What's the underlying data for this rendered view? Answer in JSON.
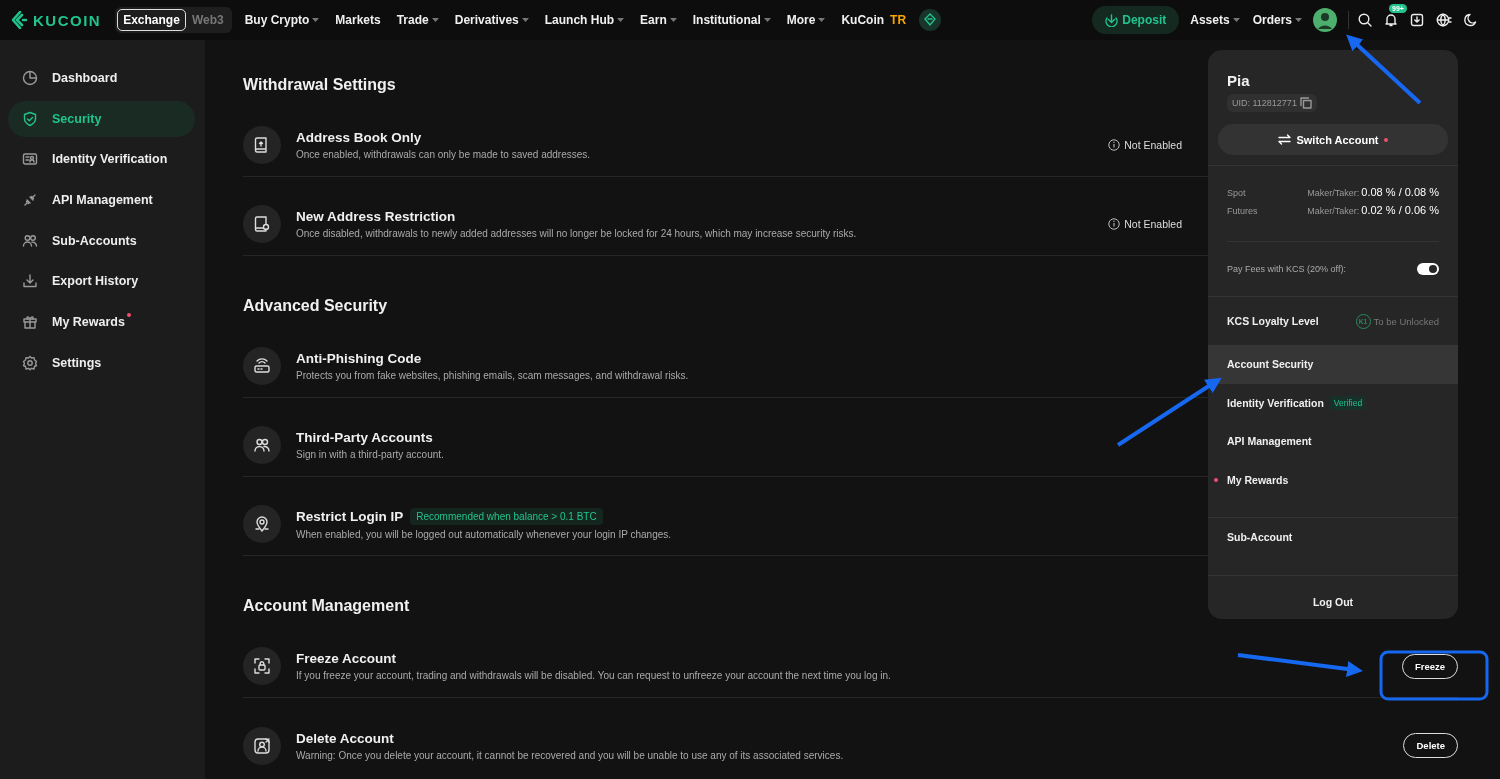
{
  "topbar": {
    "logo": "KUCOIN",
    "switch": [
      {
        "label": "Exchange",
        "selected": true
      },
      {
        "label": "Web3",
        "selected": false
      }
    ],
    "nav": [
      {
        "label": "Buy Crypto",
        "dropdown": true
      },
      {
        "label": "Markets",
        "dropdown": false
      },
      {
        "label": "Trade",
        "dropdown": true
      },
      {
        "label": "Derivatives",
        "dropdown": true
      },
      {
        "label": "Launch Hub",
        "dropdown": true
      },
      {
        "label": "Earn",
        "dropdown": true
      },
      {
        "label": "Institutional",
        "dropdown": true
      },
      {
        "label": "More",
        "dropdown": true
      }
    ],
    "region": {
      "label": "KuCoin",
      "badge": "TR"
    },
    "deposit": "Deposit",
    "menus": [
      {
        "label": "Assets",
        "dropdown": true
      },
      {
        "label": "Orders",
        "dropdown": true
      }
    ],
    "notifications": "99+"
  },
  "sidebar": {
    "items": [
      {
        "label": "Dashboard",
        "selected": false,
        "dot": false
      },
      {
        "label": "Security",
        "selected": true,
        "dot": false
      },
      {
        "label": "Identity Verification",
        "selected": false,
        "dot": false
      },
      {
        "label": "API Management",
        "selected": false,
        "dot": false
      },
      {
        "label": "Sub-Accounts",
        "selected": false,
        "dot": false
      },
      {
        "label": "Export History",
        "selected": false,
        "dot": false
      },
      {
        "label": "My Rewards",
        "selected": false,
        "dot": true
      },
      {
        "label": "Settings",
        "selected": false,
        "dot": false
      }
    ]
  },
  "sections": [
    {
      "title": "Withdrawal Settings",
      "rows": [
        {
          "title": "Address Book Only",
          "description": "Once enabled, withdrawals can only be made to saved addresses.",
          "status": "Not Enabled"
        },
        {
          "title": "New Address Restriction",
          "description": "Once disabled, withdrawals to newly added addresses will no longer be locked for 24 hours, which may increase security risks.",
          "status": "Not Enabled"
        }
      ]
    },
    {
      "title": "Advanced Security",
      "rows": [
        {
          "title": "Anti-Phishing Code",
          "description": "Protects you from fake websites, phishing emails, scam messages, and withdrawal risks."
        },
        {
          "title": "Third-Party Accounts",
          "description": "Sign in with a third-party account."
        },
        {
          "title": "Restrict Login IP",
          "tag": "Recommended when balance > 0.1 BTC",
          "description": "When enabled, you will be logged out automatically whenever your login IP changes."
        }
      ]
    },
    {
      "title": "Account Management",
      "rows": [
        {
          "title": "Freeze Account",
          "description": "If you freeze your account, trading and withdrawals will be disabled. You can request to unfreeze your account the next time you log in.",
          "action": "Freeze"
        },
        {
          "title": "Delete Account",
          "description": "Warning: Once you delete your account, it cannot be recovered and you will be unable to use any of its associated services.",
          "action": "Delete"
        }
      ]
    }
  ],
  "account_menu": {
    "name": "Pia",
    "uid": "UID: 112812771",
    "switch_account": {
      "label": "Switch Account",
      "dot": true
    },
    "fees": [
      {
        "market": "Spot",
        "label": "Maker/Taker:",
        "value": "0.08 % / 0.08 %"
      },
      {
        "market": "Futures",
        "label": "Maker/Taker:",
        "value": "0.02 % / 0.06 %"
      }
    ],
    "pay_with_kcs": {
      "label": "Pay Fees with KCS (20% off):",
      "on": true
    },
    "loyalty": {
      "label": "KCS Loyalty Level",
      "badge": "K1",
      "status": "To be Unlocked"
    },
    "items": [
      {
        "label": "Account Security",
        "selected": true,
        "dot": false
      },
      {
        "label": "Identity Verification",
        "selected": false,
        "dot": false,
        "badge": "Verified"
      },
      {
        "label": "API Management",
        "selected": false,
        "dot": false
      },
      {
        "label": "My Rewards",
        "selected": false,
        "dot": true
      }
    ],
    "sub_account": "Sub-Account",
    "logout": "Log Out"
  }
}
